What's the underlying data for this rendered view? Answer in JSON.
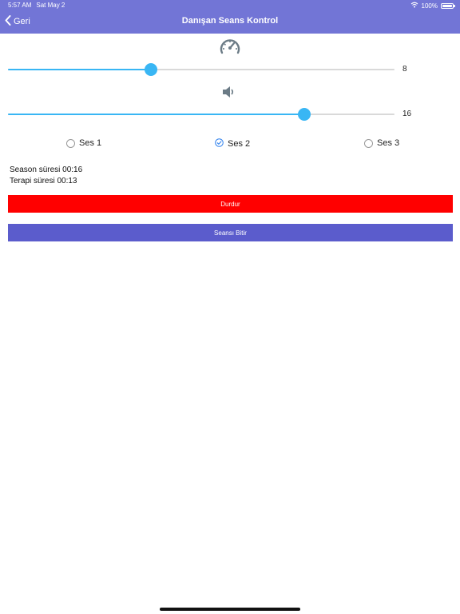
{
  "status_bar": {
    "time": "5:57 AM",
    "date": "Sat May 2",
    "battery": "100%",
    "icons": [
      "wifi-icon",
      "battery-icon"
    ]
  },
  "nav": {
    "back_label": "Geri",
    "title": "Danışan Seans Kontrol"
  },
  "speed": {
    "icon": "speedometer-icon",
    "value": "8",
    "fraction": 0.369
  },
  "volume": {
    "icon": "speaker-icon",
    "value": "16",
    "fraction": 0.766
  },
  "sounds": [
    {
      "label": "Ses 1",
      "selected": false
    },
    {
      "label": "Ses 2",
      "selected": true
    },
    {
      "label": "Ses 3",
      "selected": false
    }
  ],
  "session": {
    "season_time": "Season süresi 00:16",
    "therapy_time": "Terapi süresi 00:13"
  },
  "buttons": {
    "stop_label": "Durdur",
    "end_label": "Seansı Bitir"
  },
  "colors": {
    "header": "#7275d6",
    "slider_accent": "#39b6f4",
    "stop_button": "#ff0000",
    "end_button": "#5b5ccc",
    "radio_selected": "#2f80ed"
  }
}
